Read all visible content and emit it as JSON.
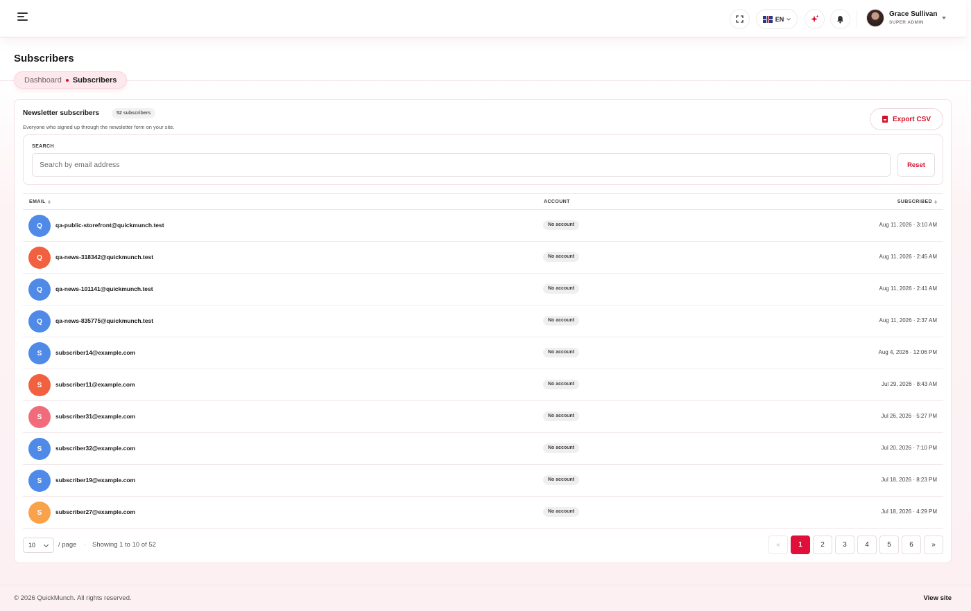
{
  "header": {
    "language": "EN",
    "user_name": "Grace Sullivan",
    "user_role": "SUPER ADMIN"
  },
  "page": {
    "title": "Subscribers",
    "breadcrumb": {
      "parent": "Dashboard",
      "current": "Subscribers"
    }
  },
  "card": {
    "title": "Newsletter subscribers",
    "count_badge": "52 subscribers",
    "description": "Everyone who signed up through the newsletter form on your site.",
    "export_label": "Export CSV",
    "search_label": "SEARCH",
    "search_placeholder": "Search by email address",
    "search_value": "",
    "reset_label": "Reset"
  },
  "table": {
    "columns": {
      "email": "EMAIL",
      "account": "ACCOUNT",
      "subscribed": "SUBSCRIBED"
    },
    "rows": [
      {
        "initial": "Q",
        "color": "#4f8ae8",
        "email": "qa-public-storefront@quickmunch.test",
        "account": "No account",
        "subscribed": "Aug 11, 2026 · 3:10 AM"
      },
      {
        "initial": "Q",
        "color": "#f1603f",
        "email": "qa-news-318342@quickmunch.test",
        "account": "No account",
        "subscribed": "Aug 11, 2026 · 2:45 AM"
      },
      {
        "initial": "Q",
        "color": "#4f8ae8",
        "email": "qa-news-101141@quickmunch.test",
        "account": "No account",
        "subscribed": "Aug 11, 2026 · 2:41 AM"
      },
      {
        "initial": "Q",
        "color": "#4f8ae8",
        "email": "qa-news-835775@quickmunch.test",
        "account": "No account",
        "subscribed": "Aug 11, 2026 · 2:37 AM"
      },
      {
        "initial": "S",
        "color": "#4f8ae8",
        "email": "subscriber14@example.com",
        "account": "No account",
        "subscribed": "Aug 4, 2026 · 12:06 PM"
      },
      {
        "initial": "S",
        "color": "#f1603f",
        "email": "subscriber11@example.com",
        "account": "No account",
        "subscribed": "Jul 29, 2026 · 8:43 AM"
      },
      {
        "initial": "S",
        "color": "#f26b7a",
        "email": "subscriber31@example.com",
        "account": "No account",
        "subscribed": "Jul 26, 2026 · 5:27 PM"
      },
      {
        "initial": "S",
        "color": "#4f8ae8",
        "email": "subscriber32@example.com",
        "account": "No account",
        "subscribed": "Jul 20, 2026 · 7:10 PM"
      },
      {
        "initial": "S",
        "color": "#4f8ae8",
        "email": "subscriber19@example.com",
        "account": "No account",
        "subscribed": "Jul 18, 2026 · 8:23 PM"
      },
      {
        "initial": "S",
        "color": "#f9a24a",
        "email": "subscriber27@example.com",
        "account": "No account",
        "subscribed": "Jul 18, 2026 · 4:29 PM"
      }
    ]
  },
  "pagination": {
    "per_page": "10",
    "per_page_label": "/ page",
    "separator": "·",
    "showing": "Showing 1 to 10 of 52",
    "prev": "«",
    "next": "»",
    "pages": [
      "1",
      "2",
      "3",
      "4",
      "5",
      "6"
    ],
    "current_page": "1"
  },
  "footer": {
    "copyright": "© 2026 QuickMunch. All rights reserved.",
    "view_site": "View site"
  },
  "colors": {
    "accent": "#e0103a",
    "brand_red": "#d0102a"
  },
  "icons": [
    "menu-icon",
    "fullscreen-icon",
    "uk-flag-icon",
    "sparkle-icon",
    "bell-icon",
    "file-icon",
    "sort-icon",
    "chevron-down-icon"
  ]
}
